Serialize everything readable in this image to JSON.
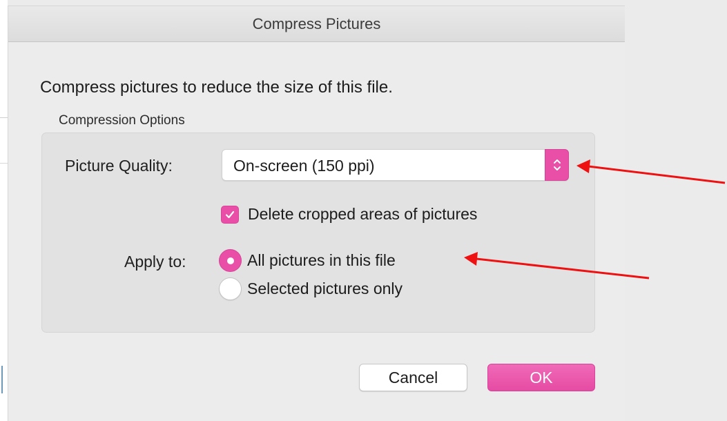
{
  "dialog": {
    "title": "Compress Pictures",
    "intro": "Compress pictures to reduce the size of this file.",
    "group_label": "Compression Options"
  },
  "quality": {
    "label": "Picture Quality:",
    "selected": "On-screen (150 ppi)"
  },
  "delete_cropped": {
    "label": "Delete cropped areas of pictures",
    "checked": true
  },
  "apply_to": {
    "label": "Apply to:",
    "options": [
      {
        "label": "All pictures in this file",
        "selected": true
      },
      {
        "label": "Selected pictures only",
        "selected": false
      }
    ]
  },
  "buttons": {
    "cancel": "Cancel",
    "ok": "OK"
  },
  "colors": {
    "accent": "#e94fa6",
    "annotation_arrow": "#ee1111"
  },
  "icons": {
    "stepper": "chevron-up-down-icon",
    "check": "checkmark-icon",
    "arrow": "red-arrow-annotation"
  }
}
